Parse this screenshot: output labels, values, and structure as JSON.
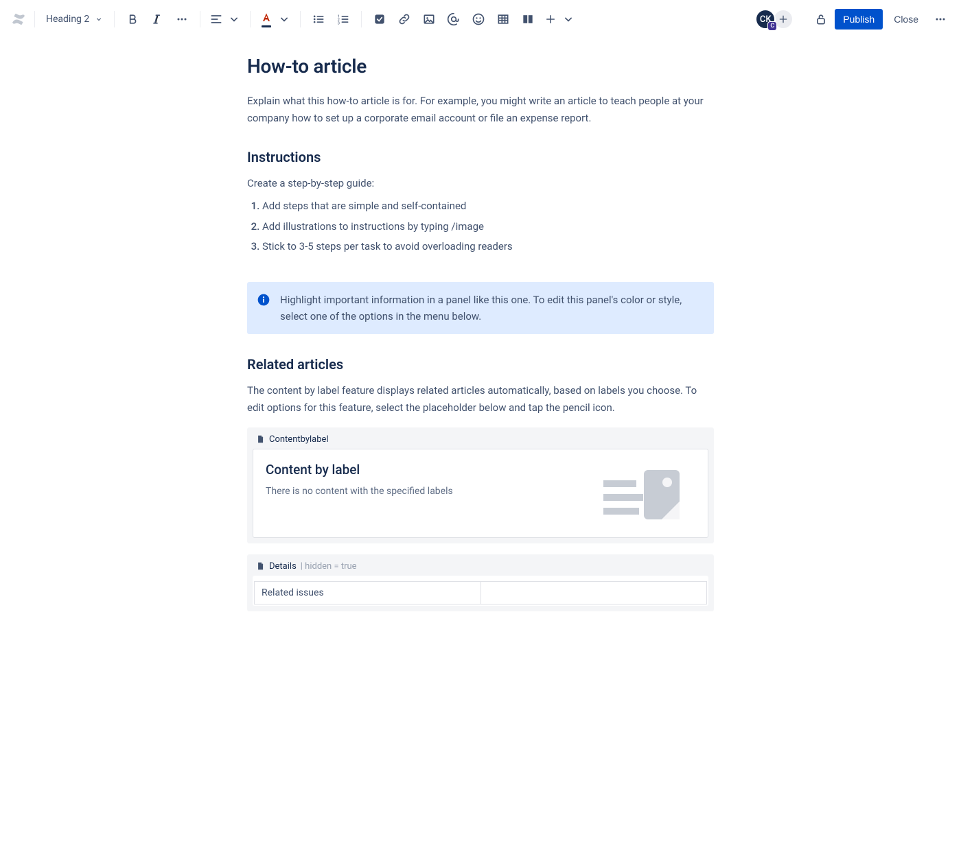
{
  "toolbar": {
    "text_style": "Heading 2",
    "publish_label": "Publish",
    "close_label": "Close"
  },
  "avatars": {
    "primary_initials": "CK",
    "primary_badge": "C"
  },
  "page": {
    "title": "How-to article",
    "intro": "Explain what this how-to article is for. For example, you might write an article to teach people at your company how to set up a corporate email account or file an expense report.",
    "instructions_heading": "Instructions",
    "instructions_intro": "Create a step-by-step guide:",
    "steps": [
      "Add steps that are simple and self-contained",
      "Add illustrations to instructions by typing /image",
      "Stick to 3-5 steps per task to avoid overloading readers"
    ],
    "panel_text": "Highlight important information in a panel like this one. To edit this panel's color or style, select one of the options in the menu below.",
    "related_heading": "Related articles",
    "related_intro": "The content by label feature displays related articles automatically, based on labels you choose. To edit options for this feature, select the placeholder below and tap the pencil icon."
  },
  "macros": {
    "content_by_label": {
      "header": "Contentbylabel",
      "title": "Content by label",
      "empty": "There is no content with the specified labels"
    },
    "details": {
      "header_name": "Details",
      "header_meta": " | hidden = true",
      "row1_label": "Related issues"
    }
  }
}
